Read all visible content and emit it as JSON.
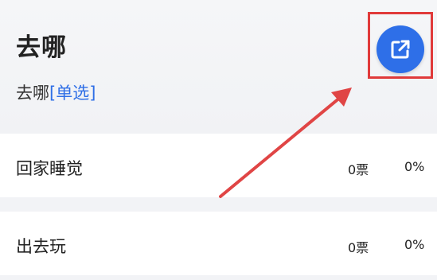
{
  "poll": {
    "title": "去哪",
    "subtitle_text": "去哪",
    "subtitle_tag": "[单选]"
  },
  "share_button": {
    "icon": "external-link-icon",
    "color": "#2e6fe8"
  },
  "options": [
    {
      "label": "回家睡觉",
      "votes": "0票",
      "percent": "0%"
    },
    {
      "label": "出去玩",
      "votes": "0票",
      "percent": "0%"
    }
  ],
  "annotation": {
    "highlight_color": "#e03a3a"
  }
}
